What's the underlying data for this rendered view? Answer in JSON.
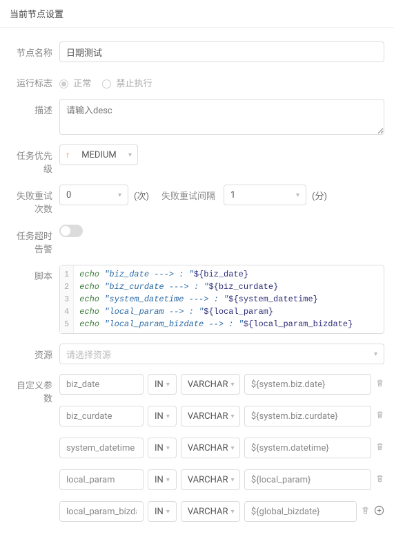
{
  "title": "当前节点设置",
  "labels": {
    "nodeName": "节点名称",
    "runFlag": "运行标志",
    "desc": "描述",
    "priority": "任务优先级",
    "retryCount": "失败重试次数",
    "retryCountUnit": "(次)",
    "retryInterval": "失败重试间隔",
    "retryIntervalUnit": "(分)",
    "timeoutAlarm": "任务超时告警",
    "script": "脚本",
    "resource": "资源",
    "customParams": "自定义参数"
  },
  "nodeName": "日期测试",
  "runFlag": {
    "options": {
      "normal": "正常",
      "forbid": "禁止执行"
    },
    "value": "normal"
  },
  "descPlaceholder": "请输入desc",
  "priority": "MEDIUM",
  "retryCount": "0",
  "retryInterval": "1",
  "resourcePlaceholder": "请选择资源",
  "script": [
    {
      "kw": "echo",
      "str": "\"biz_date ---> : \"",
      "var": "${biz_date}"
    },
    {
      "kw": "echo",
      "str": "\"biz_curdate ---> : \"",
      "var": "${biz_curdate}"
    },
    {
      "kw": "echo",
      "str": "\"system_datetime ---> : \"",
      "var": "${system_datetime}"
    },
    {
      "kw": "echo",
      "str": "\"local_param --> : \"",
      "var": "${local_param}"
    },
    {
      "kw": "echo",
      "str": "\"local_param_bizdate --> : \"",
      "var": "${local_param_bizdate}"
    }
  ],
  "params": [
    {
      "name": "biz_date",
      "dir": "IN",
      "type": "VARCHAR",
      "value": "${system.biz.date}"
    },
    {
      "name": "biz_curdate",
      "dir": "IN",
      "type": "VARCHAR",
      "value": "${system.biz.curdate}"
    },
    {
      "name": "system_datetime",
      "dir": "IN",
      "type": "VARCHAR",
      "value": "${system.datetime}"
    },
    {
      "name": "local_param",
      "dir": "IN",
      "type": "VARCHAR",
      "value": "${local_param}"
    },
    {
      "name": "local_param_bizdate",
      "dir": "IN",
      "type": "VARCHAR",
      "value": "${global_bizdate}"
    }
  ]
}
